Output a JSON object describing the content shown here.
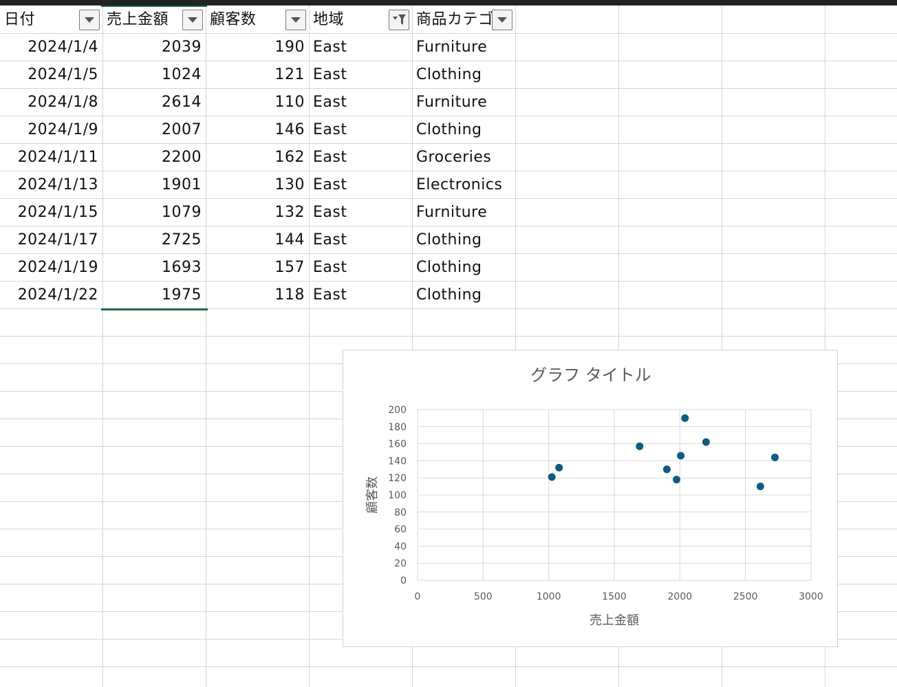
{
  "columns": [
    {
      "label": "日付",
      "filter": "dropdown"
    },
    {
      "label": "売上金額",
      "filter": "dropdown"
    },
    {
      "label": "顧客数",
      "filter": "dropdown"
    },
    {
      "label": "地域",
      "filter": "filtered"
    },
    {
      "label": "商品カテゴ",
      "filter": "dropdown"
    }
  ],
  "rows": [
    {
      "date": "2024/1/4",
      "sales": "2039",
      "customers": "190",
      "region": "East",
      "category": "Furniture"
    },
    {
      "date": "2024/1/5",
      "sales": "1024",
      "customers": "121",
      "region": "East",
      "category": "Clothing"
    },
    {
      "date": "2024/1/8",
      "sales": "2614",
      "customers": "110",
      "region": "East",
      "category": "Furniture"
    },
    {
      "date": "2024/1/9",
      "sales": "2007",
      "customers": "146",
      "region": "East",
      "category": "Clothing"
    },
    {
      "date": "2024/1/11",
      "sales": "2200",
      "customers": "162",
      "region": "East",
      "category": "Groceries"
    },
    {
      "date": "2024/1/13",
      "sales": "1901",
      "customers": "130",
      "region": "East",
      "category": "Electronics"
    },
    {
      "date": "2024/1/15",
      "sales": "1079",
      "customers": "132",
      "region": "East",
      "category": "Furniture"
    },
    {
      "date": "2024/1/17",
      "sales": "2725",
      "customers": "144",
      "region": "East",
      "category": "Clothing"
    },
    {
      "date": "2024/1/19",
      "sales": "1693",
      "customers": "157",
      "region": "East",
      "category": "Clothing"
    },
    {
      "date": "2024/1/22",
      "sales": "1975",
      "customers": "118",
      "region": "East",
      "category": "Clothing"
    }
  ],
  "colors": {
    "accent": "#1e6b41",
    "marker": "#0f5a80",
    "grid": "#d4d4d4"
  },
  "chart_data": {
    "type": "scatter",
    "title": "グラフ タイトル",
    "xlabel": "売上金額",
    "ylabel": "顧客数",
    "xlim": [
      0,
      3000
    ],
    "ylim": [
      0,
      200
    ],
    "xticks": [
      "0",
      "500",
      "1000",
      "1500",
      "2000",
      "2500",
      "3000"
    ],
    "yticks": [
      "0",
      "20",
      "40",
      "60",
      "80",
      "100",
      "120",
      "140",
      "160",
      "180",
      "200"
    ],
    "grid": true,
    "marker_color": "#0f5a80",
    "points": [
      {
        "x": 2039,
        "y": 190
      },
      {
        "x": 1024,
        "y": 121
      },
      {
        "x": 2614,
        "y": 110
      },
      {
        "x": 2007,
        "y": 146
      },
      {
        "x": 2200,
        "y": 162
      },
      {
        "x": 1901,
        "y": 130
      },
      {
        "x": 1079,
        "y": 132
      },
      {
        "x": 2725,
        "y": 144
      },
      {
        "x": 1693,
        "y": 157
      },
      {
        "x": 1975,
        "y": 118
      }
    ]
  }
}
